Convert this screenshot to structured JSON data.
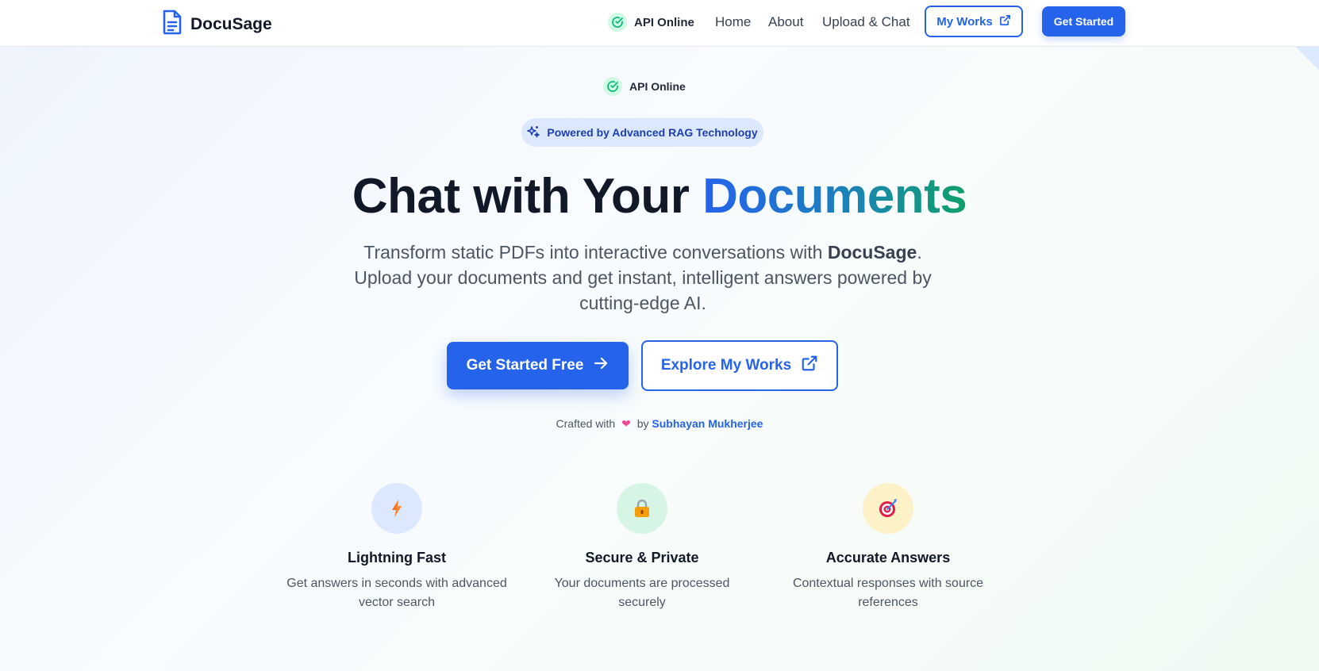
{
  "header": {
    "logo_text": "DocuSage",
    "api_status": "API Online",
    "nav": [
      "Home",
      "About",
      "Upload & Chat"
    ],
    "my_works": "My Works",
    "get_started": "Get Started"
  },
  "hero": {
    "api_status": "API Online",
    "badge": "Powered by Advanced RAG Technology",
    "title_part1": "Chat with Your ",
    "title_highlight": "Documents",
    "subtitle_pre": "Transform static PDFs into interactive conversations with ",
    "subtitle_brand": "DocuSage",
    "subtitle_post": ". Upload your documents and get instant, intelligent answers powered by cutting-edge AI.",
    "cta_primary": "Get Started Free",
    "cta_secondary": "Explore My Works",
    "crafted_pre": "Crafted with",
    "crafted_by": "by",
    "author": "Subhayan Mukherjee"
  },
  "features": [
    {
      "title": "Lightning Fast",
      "desc": "Get answers in seconds with advanced vector search"
    },
    {
      "title": "Secure & Private",
      "desc": "Your documents are processed securely"
    },
    {
      "title": "Accurate Answers",
      "desc": "Contextual responses with source references"
    }
  ],
  "colors": {
    "primary": "#2563eb",
    "success": "#10b981",
    "heart": "#ec4899"
  }
}
